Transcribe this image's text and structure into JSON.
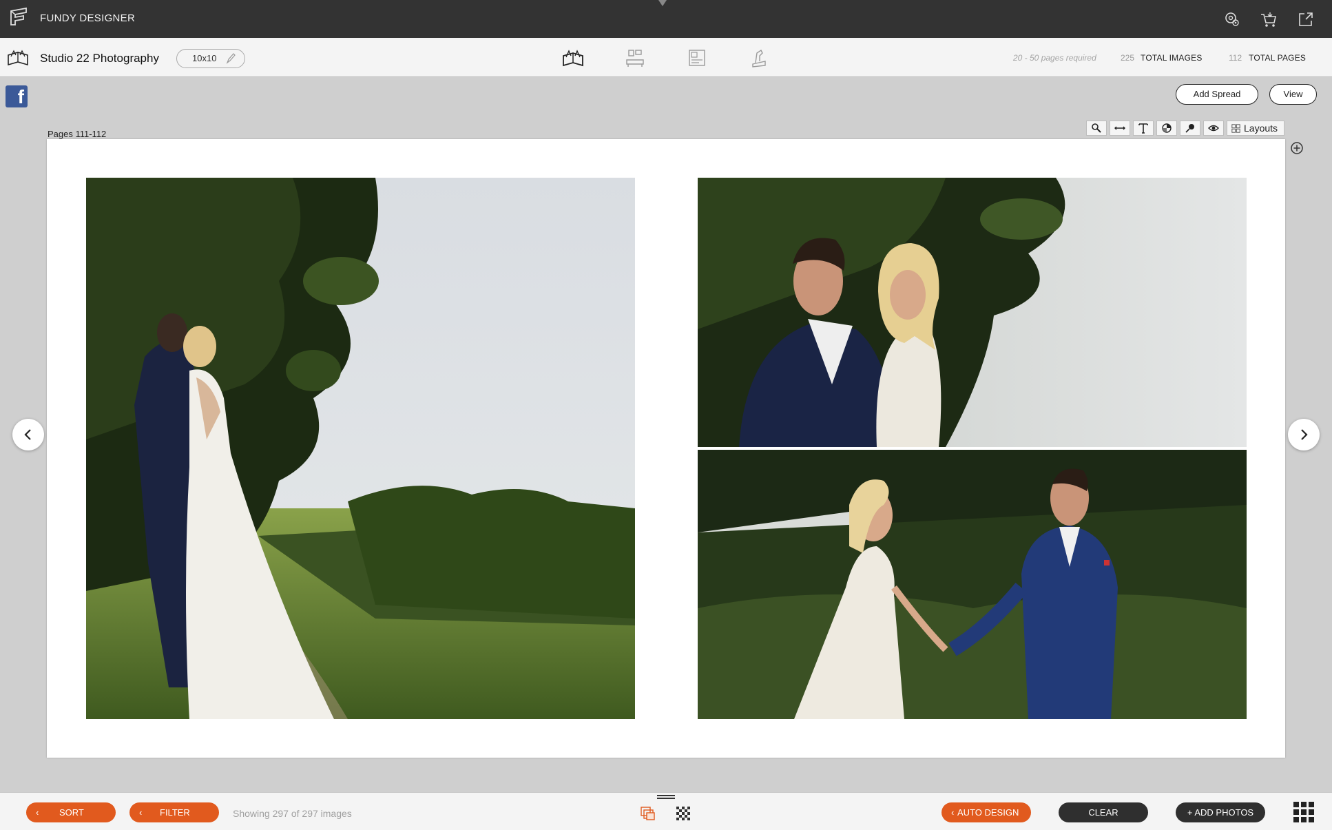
{
  "window": {
    "app_title": "FUNDY DESIGNER"
  },
  "toolbar": {
    "studio_name": "Studio 22 Photography",
    "album_size": "10x10",
    "pages_required": "20 - 50 pages required",
    "total_images_count": "225",
    "total_images_label": "TOTAL IMAGES",
    "total_pages_count": "112",
    "total_pages_label": "TOTAL PAGES",
    "modes": [
      "album-designer-icon",
      "wall-art-icon",
      "card-designer-icon",
      "design-service-icon"
    ]
  },
  "actions": {
    "add_spread": "Add Spread",
    "view": "View"
  },
  "spread": {
    "pages_label": "Pages 111-112",
    "layouts_label": "Layouts",
    "tools": [
      "zoom-icon",
      "width-icon",
      "text-icon",
      "color-icon",
      "pin-icon",
      "eye-icon"
    ],
    "photos": [
      {
        "name": "couple-embrace-photo"
      },
      {
        "name": "couple-portrait-photo"
      },
      {
        "name": "couple-holding-hands-photo"
      }
    ]
  },
  "bottom": {
    "sort": "SORT",
    "filter": "FILTER",
    "showing": "Showing 297 of 297 images",
    "auto_design": "AUTO DESIGN",
    "clear": "CLEAR",
    "add_photos": "+ ADD PHOTOS"
  },
  "colors": {
    "accent": "#e15a1e",
    "titlebar": "#333333",
    "facebook": "#3b5998"
  }
}
